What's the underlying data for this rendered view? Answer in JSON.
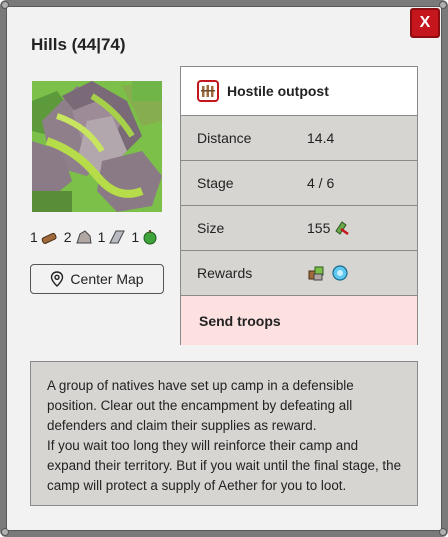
{
  "window": {
    "title": "Hills (44|74)",
    "close_label": "X"
  },
  "resources": [
    {
      "count": "1",
      "icon": "wood-icon"
    },
    {
      "count": "2",
      "icon": "stone-icon"
    },
    {
      "count": "1",
      "icon": "metal-icon"
    },
    {
      "count": "1",
      "icon": "food-icon"
    }
  ],
  "center_map_label": "Center Map",
  "info": {
    "header": "Hostile outpost",
    "rows": [
      {
        "key": "Distance",
        "value": "14.4"
      },
      {
        "key": "Stage",
        "value": "4 / 6"
      },
      {
        "key": "Size",
        "value": "155"
      },
      {
        "key": "Rewards",
        "value": ""
      }
    ],
    "send_troops_label": "Send troops"
  },
  "description": [
    "A group of natives have set up camp in a defensible position. Clear out the encampment by defeating all defenders and claim their supplies as reward.",
    "If you wait too long they will reinforce their camp and expand their territory. But if you wait until the final stage, the camp will protect a supply of Aether for you to loot."
  ],
  "colors": {
    "close_red": "#c4161c",
    "send_bg": "#fde1e1",
    "row_bg": "#d7d5d1",
    "accent_green": "#4caf50"
  }
}
